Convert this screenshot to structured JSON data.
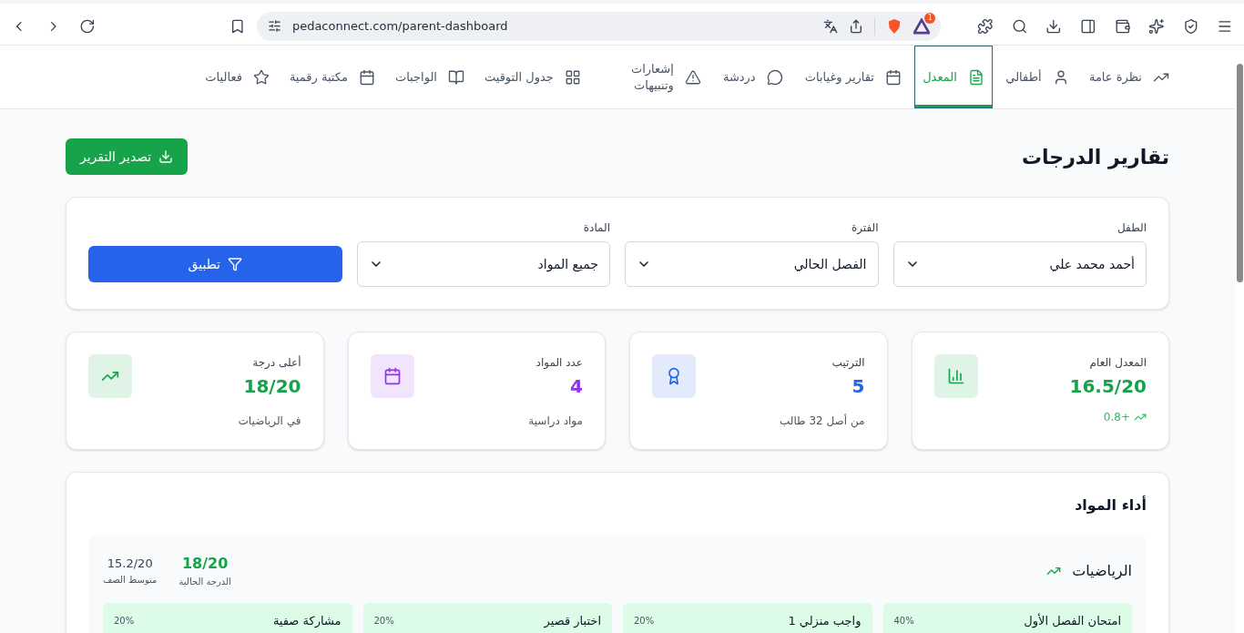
{
  "browser": {
    "url": "pedaconnect.com/parent-dashboard",
    "badge": "1"
  },
  "nav": [
    {
      "label": "نظرة عامة",
      "selected": false
    },
    {
      "label": "أطفالي",
      "selected": false
    },
    {
      "label": "المعدل",
      "selected": true
    },
    {
      "label": "تقارير وغيابات",
      "selected": false
    },
    {
      "label": "دردشة",
      "selected": false
    },
    {
      "label": "إشعارات وتنبيهات",
      "selected": false
    },
    {
      "label": "جدول التوقيت",
      "selected": false
    },
    {
      "label": "الواجبات",
      "selected": false
    },
    {
      "label": "مكتبة رقمية",
      "selected": false
    },
    {
      "label": "فعاليات",
      "selected": false
    }
  ],
  "page_title": "تقارير الدرجات",
  "export_button": "تصدير التقرير",
  "filters": [
    {
      "label": "الطفل",
      "value": "أحمد محمد علي"
    },
    {
      "label": "الفترة",
      "value": "الفصل الحالي"
    },
    {
      "label": "المادة",
      "value": "جميع المواد"
    }
  ],
  "apply_button": "تطبيق",
  "stats": [
    {
      "label": "المعدل العام",
      "value": "16.5/20",
      "sub": "+0.8",
      "kind": "trend",
      "color": "#16a34a"
    },
    {
      "label": "الترتيب",
      "value": "5",
      "sub": "من أصل 32 طالب",
      "kind": "text",
      "color": "#2563eb"
    },
    {
      "label": "عدد المواد",
      "value": "4",
      "sub": "مواد دراسية",
      "kind": "text",
      "color": "#9333ea"
    },
    {
      "label": "أعلى درجة",
      "value": "18/20",
      "sub": "في الرياضيات",
      "kind": "text",
      "color": "#16a34a"
    }
  ],
  "subjects_title": "أداء المواد",
  "subjects": [
    {
      "name": "الرياضيات",
      "current": "18/20",
      "current_label": "الدرجة الحالية",
      "average": "15.2/20",
      "average_label": "متوسط الصف",
      "assessments": [
        {
          "name": "امتحان الفصل الأول",
          "weight": "40%"
        },
        {
          "name": "واجب منزلي 1",
          "weight": "20%"
        },
        {
          "name": "اختبار قصير",
          "weight": "20%"
        },
        {
          "name": "مشاركة صفية",
          "weight": "20%"
        }
      ]
    }
  ]
}
